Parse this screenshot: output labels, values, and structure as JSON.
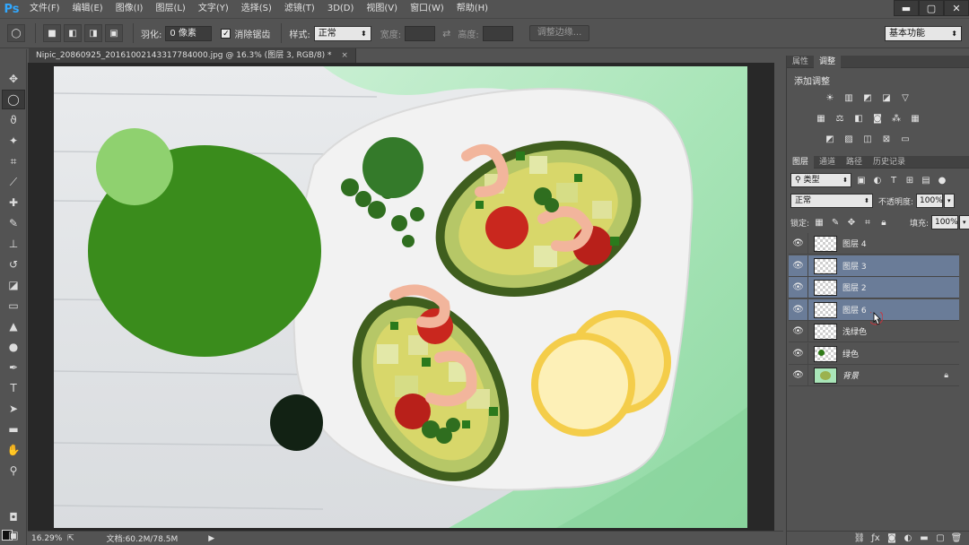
{
  "app": {
    "logo": "Ps"
  },
  "menu": [
    "文件(F)",
    "编辑(E)",
    "图像(I)",
    "图层(L)",
    "文字(Y)",
    "选择(S)",
    "滤镜(T)",
    "3D(D)",
    "视图(V)",
    "窗口(W)",
    "帮助(H)"
  ],
  "window_controls": [
    "minimize-icon",
    "maximize-icon",
    "close-icon"
  ],
  "options": {
    "feather_label": "羽化:",
    "feather_value": "0 像素",
    "antialias_label": "消除锯齿",
    "antialias_checked": true,
    "style_label": "样式:",
    "style_value": "正常",
    "width_label": "宽度:",
    "height_label": "高度:",
    "refine_edge_label": "调整边缘...",
    "workspace": "基本功能"
  },
  "document": {
    "tab_title": "Nipic_20860925_20161002143317784000.jpg @ 16.3% (图层 3, RGB/8) *",
    "close": "×"
  },
  "status": {
    "zoom": "16.29%",
    "doc_info": "文档:60.2M/78.5M"
  },
  "adjust_panel": {
    "tabs": [
      "属性",
      "调整"
    ],
    "active_tab": "调整",
    "title": "添加调整"
  },
  "layers_panel": {
    "tabs": [
      "图层",
      "通道",
      "路径",
      "历史记录"
    ],
    "active_tab": "图层",
    "filter_kind": "类型",
    "blend_mode": "正常",
    "opacity_label": "不透明度:",
    "opacity_value": "100%",
    "lock_label": "锁定:",
    "fill_label": "填充:",
    "fill_value": "100%",
    "layers": [
      {
        "name": "图层 4",
        "selected": false,
        "type": "transparent"
      },
      {
        "name": "图层 3",
        "selected": true,
        "type": "transparent"
      },
      {
        "name": "图层 2",
        "selected": true,
        "type": "transparent"
      },
      {
        "name": "图层 6",
        "selected": true,
        "type": "transparent"
      },
      {
        "name": "浅绿色",
        "selected": false,
        "type": "transparent"
      },
      {
        "name": "绿色",
        "selected": false,
        "type": "green-dot"
      },
      {
        "name": "背景",
        "selected": false,
        "type": "photo",
        "locked": true
      }
    ]
  },
  "colors": {
    "big_circle": "#3a8c1c",
    "light_circle": "#8fd16f",
    "mid_circle": "#347a2a",
    "dark_circle": "#122214",
    "selection_highlight": "#6a7c98"
  }
}
